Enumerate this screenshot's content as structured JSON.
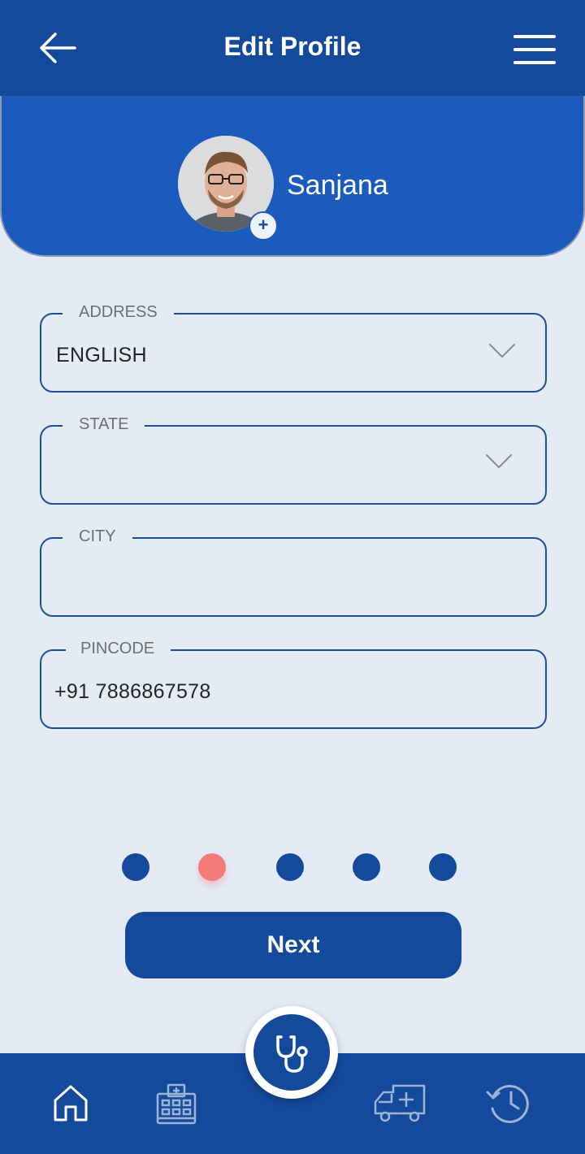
{
  "header": {
    "title": "Edit Profile",
    "back_icon": "arrow-left-icon",
    "menu_icon": "hamburger-menu-icon"
  },
  "profile": {
    "name": "Sanjana",
    "add_photo_symbol": "+",
    "avatar_icon": "user-avatar"
  },
  "form": {
    "address": {
      "label": "ADDRESS",
      "value": "ENGLISH"
    },
    "state": {
      "label": "STATE",
      "value": ""
    },
    "city": {
      "label": "CITY",
      "value": ""
    },
    "pincode": {
      "label": "PINCODE",
      "value": "+91 7886867578"
    }
  },
  "pager": {
    "total": 5,
    "current": 2
  },
  "actions": {
    "next_label": "Next"
  },
  "bottom_nav": {
    "items": [
      "home-icon",
      "hospital-icon",
      "stethoscope-icon",
      "ambulance-icon",
      "history-icon"
    ]
  },
  "colors": {
    "primary": "#134a9c",
    "header_card": "#1a5bbd",
    "background": "#e4ebf5",
    "active_dot": "#f47a7a",
    "field_border": "#1d4f9c",
    "label_gray": "#6b7078"
  }
}
